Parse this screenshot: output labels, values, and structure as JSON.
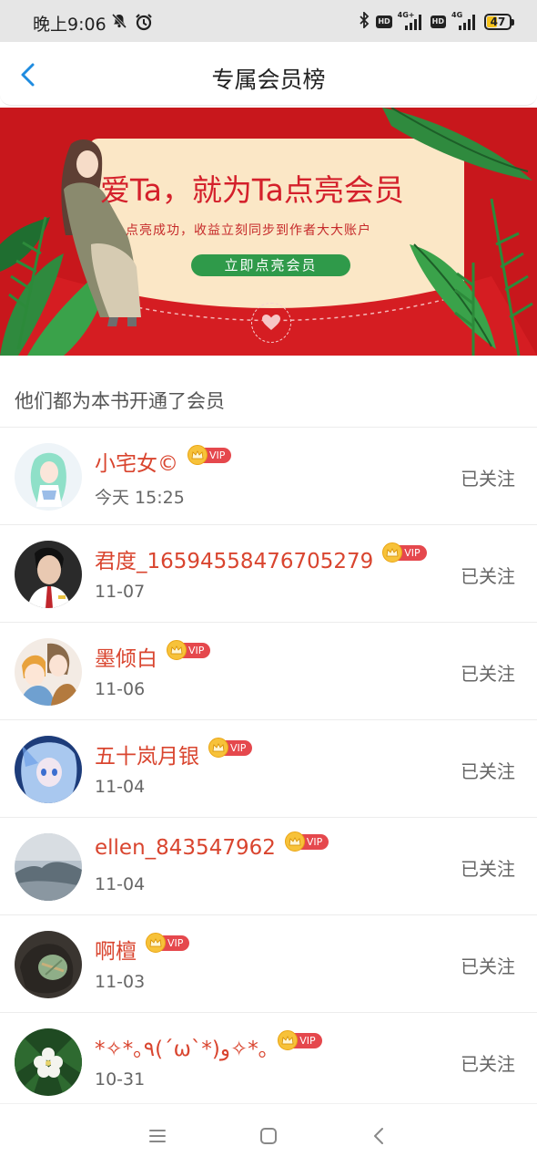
{
  "status_bar": {
    "time": "晚上9:06",
    "icons": [
      "mute-icon",
      "alarm-icon",
      "bluetooth-icon",
      "hd-icon",
      "signal-4g-plus-icon",
      "hd-icon",
      "signal-4g-icon",
      "battery-icon"
    ],
    "hd_label": "HD",
    "signal1_label": "4G+",
    "signal2_label": "4G",
    "battery_level": "47",
    "battery_color": "#f5c21a"
  },
  "header": {
    "title": "专属会员榜",
    "back_icon": "chevron-left-icon",
    "accent_color": "#1f8ce0"
  },
  "banner": {
    "headline": "爱Ta，就为Ta点亮会员",
    "subtitle": "点亮成功，收益立刻同步到作者大大账户",
    "cta_label": "立即点亮会员",
    "background_color": "#c8171c"
  },
  "section": {
    "title": "他们都为本书开通了会员"
  },
  "vip_label": "VIP",
  "members": [
    {
      "name": "小宅女©",
      "date": "今天 15:25",
      "follow": "已关注"
    },
    {
      "name": "君度_16594558476705279",
      "date": "11-07",
      "follow": "已关注"
    },
    {
      "name": "墨倾白",
      "date": "11-06",
      "follow": "已关注"
    },
    {
      "name": "五十岚月银",
      "date": "11-04",
      "follow": "已关注"
    },
    {
      "name": "ellen_843547962",
      "date": "11-04",
      "follow": "已关注"
    },
    {
      "name": "啊檀",
      "date": "11-03",
      "follow": "已关注"
    },
    {
      "name": "*✧*｡٩(ˊωˋ*)و✧*｡",
      "date": "10-31",
      "follow": "已关注"
    }
  ],
  "bottom_nav": {
    "icons": [
      "menu-icon",
      "home-icon",
      "back-icon"
    ]
  }
}
